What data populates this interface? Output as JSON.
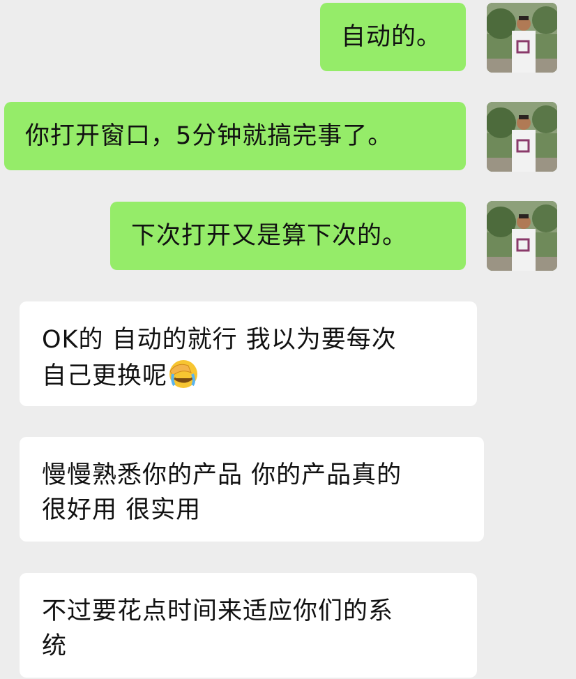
{
  "messages": [
    {
      "direction": "outgoing",
      "text": "自动的。"
    },
    {
      "direction": "outgoing",
      "text": "你打开窗口，5分钟就搞完事了。"
    },
    {
      "direction": "outgoing",
      "text": "下次打开又是算下次的。"
    },
    {
      "direction": "incoming",
      "line1": "OK的 自动的就行 我以为要每次",
      "line2": "自己更换呢",
      "emoji": "facepalm-crying-emoji"
    },
    {
      "direction": "incoming",
      "line1": "慢慢熟悉你的产品 你的产品真的",
      "line2": "很好用 很实用"
    },
    {
      "direction": "incoming",
      "line1": "不过要花点时间来适应你们的系",
      "line2": "统"
    }
  ],
  "colors": {
    "background": "#ededed",
    "outgoing_bubble": "#95ec69",
    "incoming_bubble": "#ffffff",
    "text": "#111111"
  }
}
